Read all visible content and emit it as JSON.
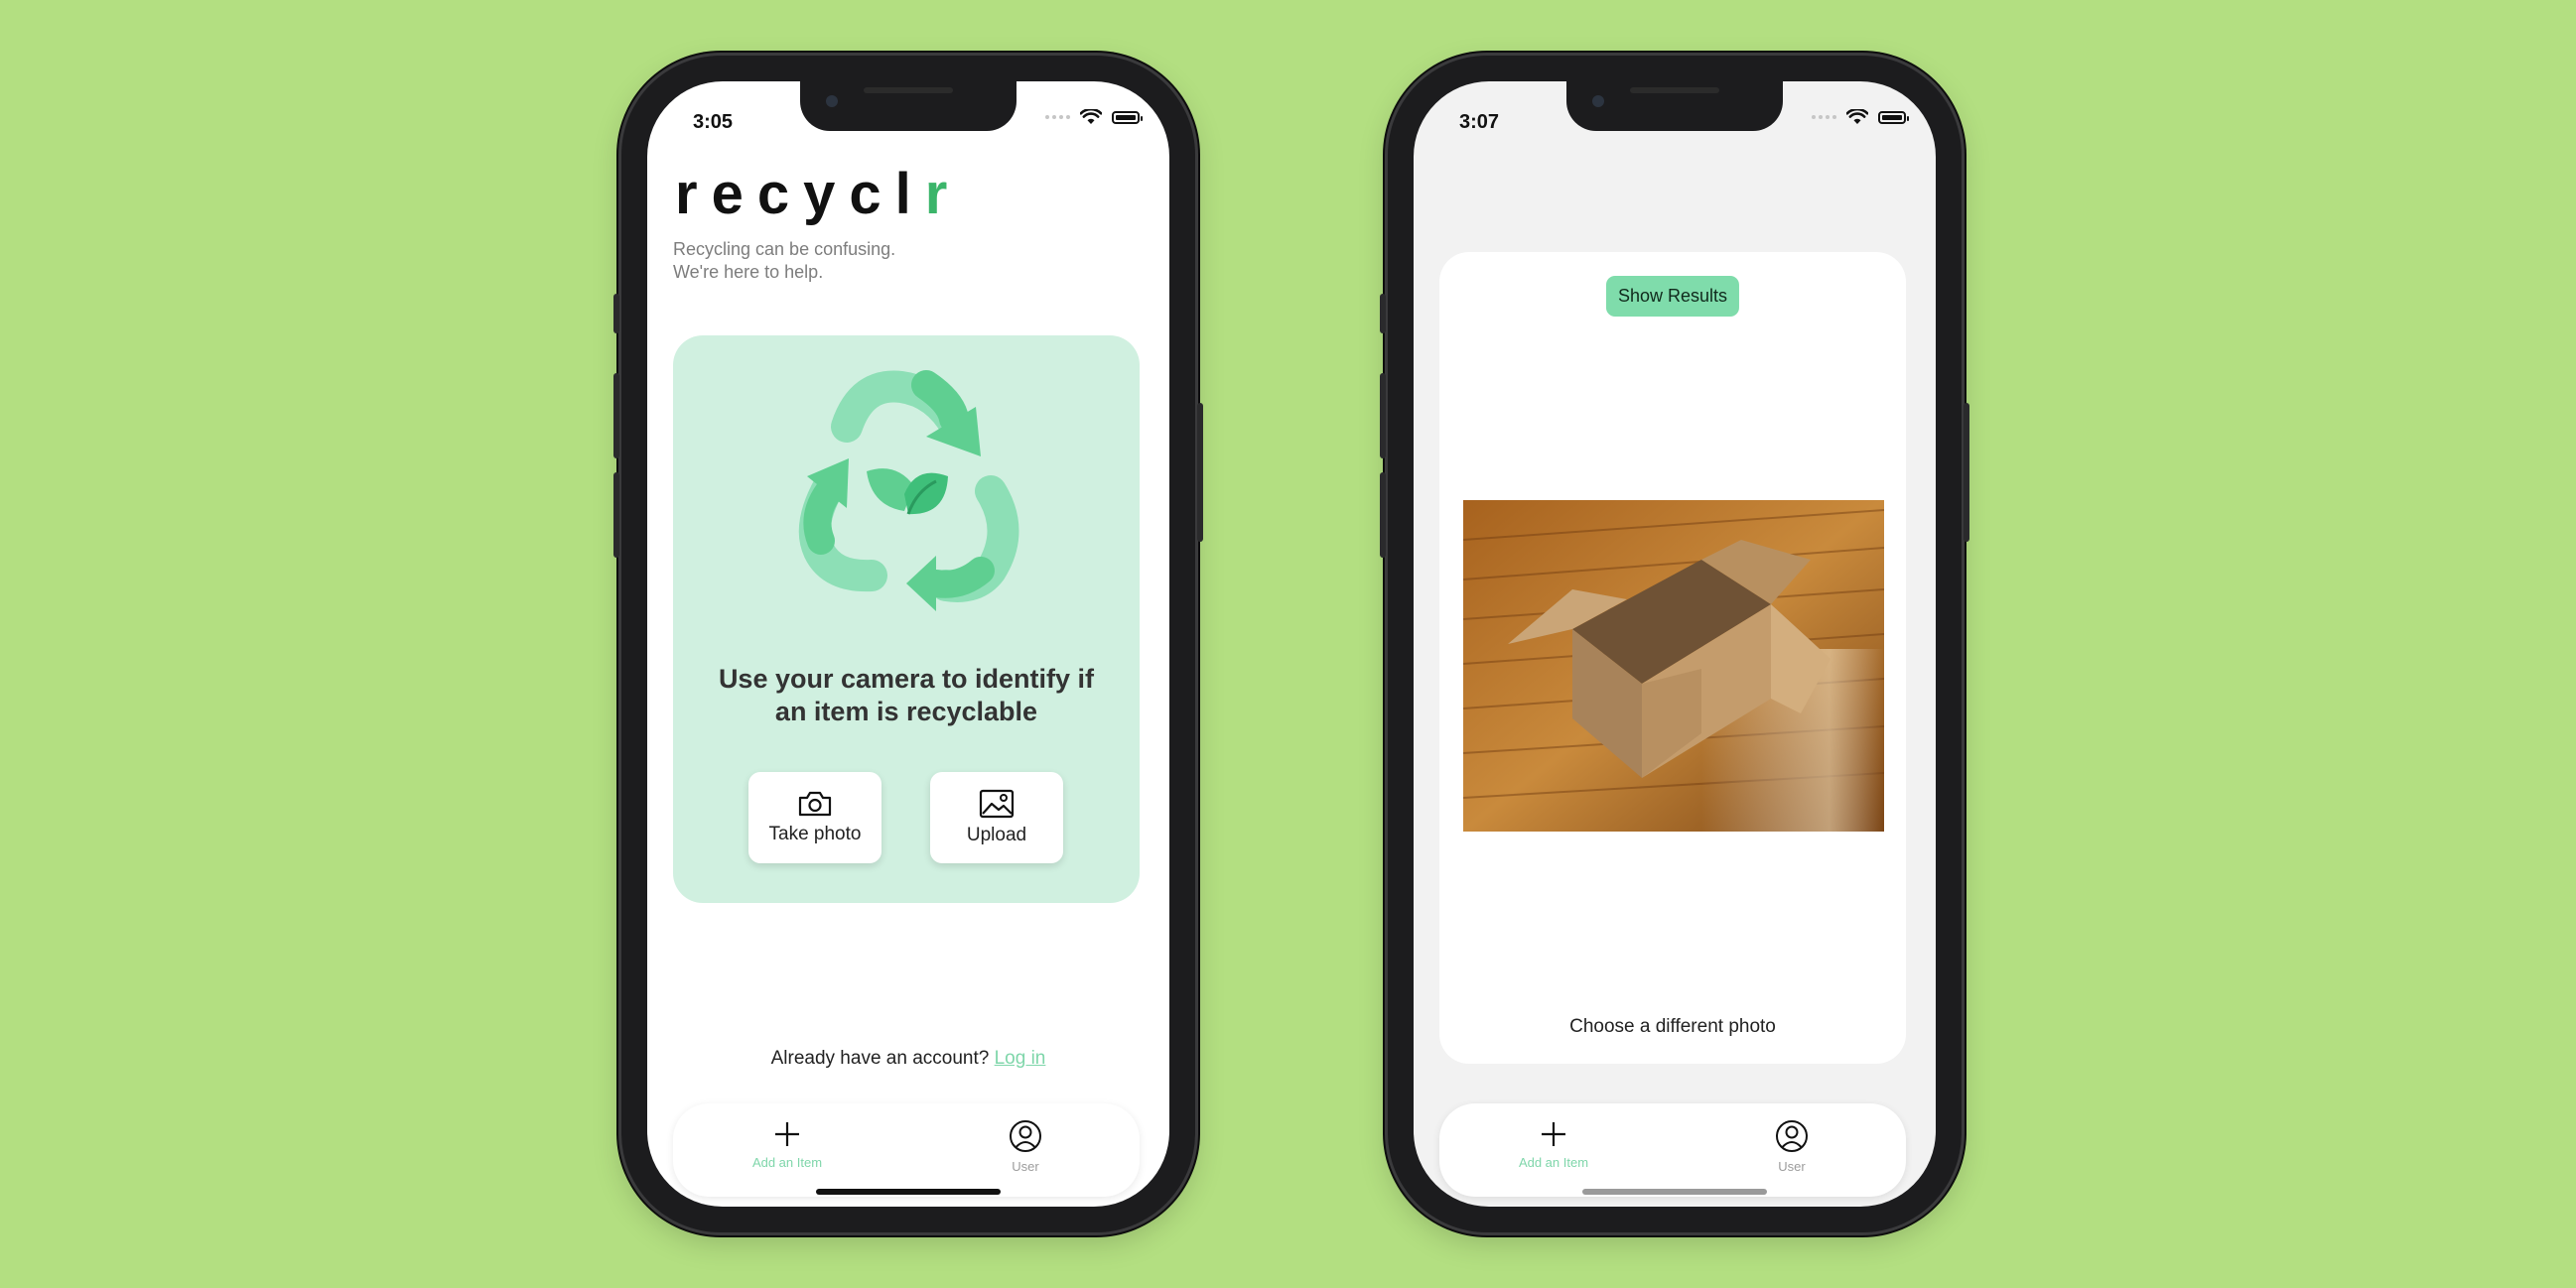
{
  "colors": {
    "background": "#b3df81",
    "accent": "#3bb56a",
    "hero_bg": "#d0f0e0",
    "link": "#7fd6aa",
    "button_green": "#7fdcab"
  },
  "left_screen": {
    "status_time": "3:05",
    "logo": {
      "main": "recycl",
      "accent": "r"
    },
    "tagline": {
      "line1": "Recycling can be confusing.",
      "line2": "We're here to help."
    },
    "hero": {
      "icon": "recycle-leaf-icon",
      "text": "Use your camera to identify if an item is recyclable",
      "take_photo": {
        "icon": "camera-icon",
        "label": "Take photo"
      },
      "upload": {
        "icon": "image-icon",
        "label": "Upload"
      }
    },
    "account": {
      "prompt": "Already have an account?",
      "link": "Log in"
    },
    "tabbar": {
      "add": {
        "icon": "plus-icon",
        "label": "Add an Item"
      },
      "user": {
        "icon": "user-circle-icon",
        "label": "User"
      }
    }
  },
  "right_screen": {
    "status_time": "3:07",
    "show_results": "Show Results",
    "photo": {
      "subject": "cardboard-box-photo"
    },
    "choose_different": "Choose a different photo",
    "tabbar": {
      "add": {
        "icon": "plus-icon",
        "label": "Add an Item"
      },
      "user": {
        "icon": "user-circle-icon",
        "label": "User"
      }
    }
  }
}
